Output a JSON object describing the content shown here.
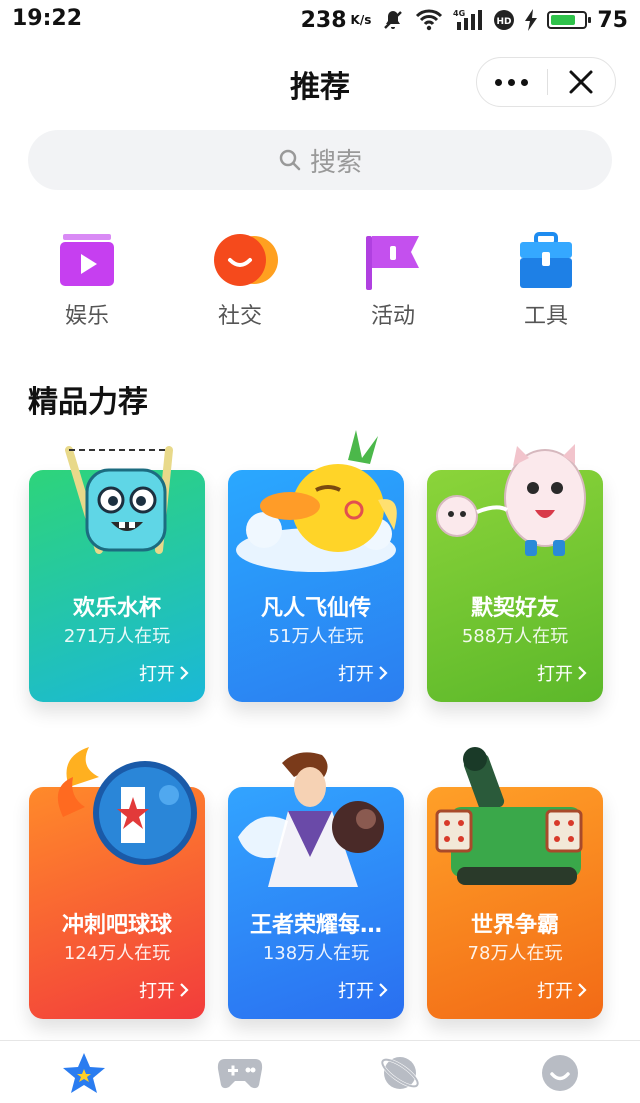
{
  "status_bar": {
    "time": "19:22",
    "speed": "238",
    "speed_unit": "K/s",
    "battery": "75",
    "battery_level": 0.75,
    "network": "4G"
  },
  "header": {
    "title": "推荐"
  },
  "search": {
    "placeholder": "搜索"
  },
  "categories": [
    {
      "label": "娱乐",
      "icon": "play-icon",
      "color": "#c63ff0"
    },
    {
      "label": "社交",
      "icon": "chat-icon",
      "color": "#f55a1c"
    },
    {
      "label": "活动",
      "icon": "flag-icon",
      "color": "#b040e0"
    },
    {
      "label": "工具",
      "icon": "toolbox-icon",
      "color": "#1e8cf0"
    }
  ],
  "section": {
    "title": "精品力荐"
  },
  "games": [
    {
      "name": "欢乐水杯",
      "players": "271万人在玩",
      "open_label": "打开",
      "color_top": "#2ed47a",
      "color_bottom": "#1ab8d8"
    },
    {
      "name": "凡人飞仙传",
      "players": "51万人在玩",
      "open_label": "打开",
      "color_top": "#2aa8ff",
      "color_bottom": "#2b7ef0"
    },
    {
      "name": "默契好友",
      "players": "588万人在玩",
      "open_label": "打开",
      "color_top": "#8bd43a",
      "color_bottom": "#5cb82a"
    },
    {
      "name": "冲刺吧球球",
      "players": "124万人在玩",
      "open_label": "打开",
      "color_top": "#ff8a2a",
      "color_bottom": "#f23c3c"
    },
    {
      "name": "王者荣耀每…",
      "players": "138万人在玩",
      "open_label": "打开",
      "color_top": "#32a4ff",
      "color_bottom": "#2a6ff0"
    },
    {
      "name": "世界争霸",
      "players": "78万人在玩",
      "open_label": "打开",
      "color_top": "#ffa028",
      "color_bottom": "#f26a16"
    }
  ],
  "tabbar": [
    {
      "icon": "star-icon",
      "active": true
    },
    {
      "icon": "gamepad-icon",
      "active": false
    },
    {
      "icon": "planet-icon",
      "active": false
    },
    {
      "icon": "smile-icon",
      "active": false
    }
  ]
}
